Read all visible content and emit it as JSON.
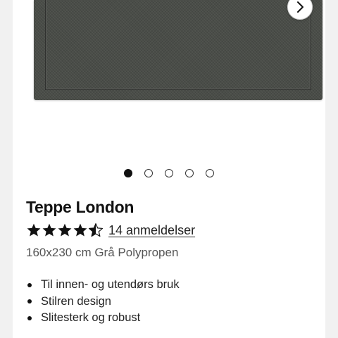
{
  "carousel": {
    "image_alt": "Teppe London",
    "next_icon": "chevron-right-icon",
    "slide_count": 5,
    "active_index": 0
  },
  "product": {
    "title": "Teppe London",
    "rating": 4.5,
    "rating_max": 5,
    "reviews_label": "14 anmeldelser",
    "subtitle": "160x230 cm Grå Polypropen",
    "features": [
      "Til innen- og utendørs bruk",
      "Stilren design",
      "Slitesterk og robust"
    ]
  },
  "colors": {
    "page_background": "#f1f1f1",
    "card_background": "#ffffff",
    "rug": "#4a4d48",
    "text": "#111111",
    "muted_text": "#555555"
  }
}
